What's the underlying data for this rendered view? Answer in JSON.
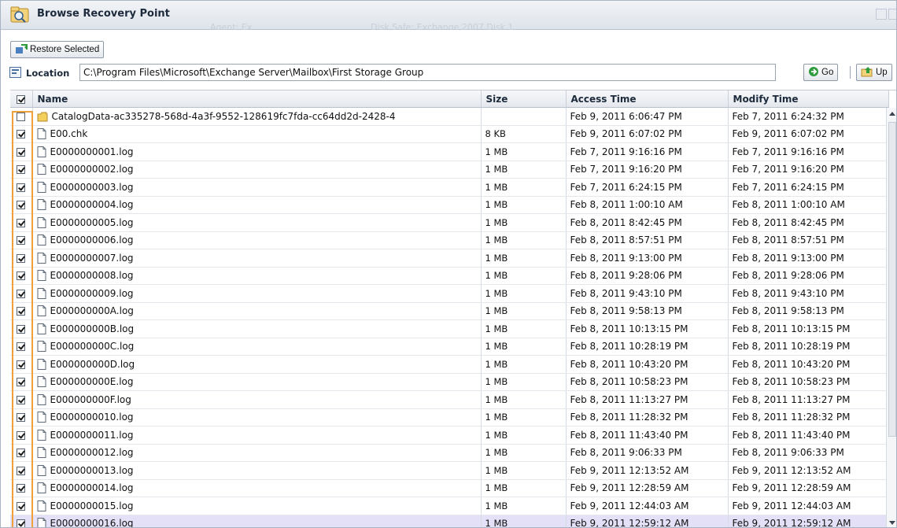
{
  "window": {
    "title": "Browse Recovery Point"
  },
  "background_ghost": {
    "items": [
      "Agent: Ex",
      "Disk Safe: Exchange 2007 Disk 1"
    ]
  },
  "toolbar": {
    "restore_label": "Restore Selected"
  },
  "location": {
    "label": "Location",
    "value": "C:\\Program Files\\Microsoft\\Exchange Server\\Mailbox\\First Storage Group",
    "go_label": "Go",
    "up_label": "Up"
  },
  "columns": {
    "name": "Name",
    "size": "Size",
    "access": "Access Time",
    "modify": "Modify Time"
  },
  "rows": [
    {
      "type": "folder",
      "checked": false,
      "name": "CatalogData-ac335278-568d-4a3f-9552-128619fc7fda-cc64dd2d-2428-4",
      "size": "",
      "access": "Feb 9, 2011 6:06:47 PM",
      "modify": "Feb 7, 2011 6:24:32 PM"
    },
    {
      "type": "file",
      "checked": true,
      "name": "E00.chk",
      "size": "8 KB",
      "access": "Feb 9, 2011 6:07:02 PM",
      "modify": "Feb 9, 2011 6:07:02 PM"
    },
    {
      "type": "file",
      "checked": true,
      "name": "E0000000001.log",
      "size": "1 MB",
      "access": "Feb 7, 2011 9:16:16 PM",
      "modify": "Feb 7, 2011 9:16:16 PM"
    },
    {
      "type": "file",
      "checked": true,
      "name": "E0000000002.log",
      "size": "1 MB",
      "access": "Feb 7, 2011 9:16:20 PM",
      "modify": "Feb 7, 2011 9:16:20 PM"
    },
    {
      "type": "file",
      "checked": true,
      "name": "E0000000003.log",
      "size": "1 MB",
      "access": "Feb 7, 2011 6:24:15 PM",
      "modify": "Feb 7, 2011 6:24:15 PM"
    },
    {
      "type": "file",
      "checked": true,
      "name": "E0000000004.log",
      "size": "1 MB",
      "access": "Feb 8, 2011 1:00:10 AM",
      "modify": "Feb 8, 2011 1:00:10 AM"
    },
    {
      "type": "file",
      "checked": true,
      "name": "E0000000005.log",
      "size": "1 MB",
      "access": "Feb 8, 2011 8:42:45 PM",
      "modify": "Feb 8, 2011 8:42:45 PM"
    },
    {
      "type": "file",
      "checked": true,
      "name": "E0000000006.log",
      "size": "1 MB",
      "access": "Feb 8, 2011 8:57:51 PM",
      "modify": "Feb 8, 2011 8:57:51 PM"
    },
    {
      "type": "file",
      "checked": true,
      "name": "E0000000007.log",
      "size": "1 MB",
      "access": "Feb 8, 2011 9:13:00 PM",
      "modify": "Feb 8, 2011 9:13:00 PM"
    },
    {
      "type": "file",
      "checked": true,
      "name": "E0000000008.log",
      "size": "1 MB",
      "access": "Feb 8, 2011 9:28:06 PM",
      "modify": "Feb 8, 2011 9:28:06 PM"
    },
    {
      "type": "file",
      "checked": true,
      "name": "E0000000009.log",
      "size": "1 MB",
      "access": "Feb 8, 2011 9:43:10 PM",
      "modify": "Feb 8, 2011 9:43:10 PM"
    },
    {
      "type": "file",
      "checked": true,
      "name": "E000000000A.log",
      "size": "1 MB",
      "access": "Feb 8, 2011 9:58:13 PM",
      "modify": "Feb 8, 2011 9:58:13 PM"
    },
    {
      "type": "file",
      "checked": true,
      "name": "E000000000B.log",
      "size": "1 MB",
      "access": "Feb 8, 2011 10:13:15 PM",
      "modify": "Feb 8, 2011 10:13:15 PM"
    },
    {
      "type": "file",
      "checked": true,
      "name": "E000000000C.log",
      "size": "1 MB",
      "access": "Feb 8, 2011 10:28:19 PM",
      "modify": "Feb 8, 2011 10:28:19 PM"
    },
    {
      "type": "file",
      "checked": true,
      "name": "E000000000D.log",
      "size": "1 MB",
      "access": "Feb 8, 2011 10:43:20 PM",
      "modify": "Feb 8, 2011 10:43:20 PM"
    },
    {
      "type": "file",
      "checked": true,
      "name": "E000000000E.log",
      "size": "1 MB",
      "access": "Feb 8, 2011 10:58:23 PM",
      "modify": "Feb 8, 2011 10:58:23 PM"
    },
    {
      "type": "file",
      "checked": true,
      "name": "E000000000F.log",
      "size": "1 MB",
      "access": "Feb 8, 2011 11:13:27 PM",
      "modify": "Feb 8, 2011 11:13:27 PM"
    },
    {
      "type": "file",
      "checked": true,
      "name": "E0000000010.log",
      "size": "1 MB",
      "access": "Feb 8, 2011 11:28:32 PM",
      "modify": "Feb 8, 2011 11:28:32 PM"
    },
    {
      "type": "file",
      "checked": true,
      "name": "E0000000011.log",
      "size": "1 MB",
      "access": "Feb 8, 2011 11:43:40 PM",
      "modify": "Feb 8, 2011 11:43:40 PM"
    },
    {
      "type": "file",
      "checked": true,
      "name": "E0000000012.log",
      "size": "1 MB",
      "access": "Feb 8, 2011 9:06:33 PM",
      "modify": "Feb 8, 2011 9:06:33 PM"
    },
    {
      "type": "file",
      "checked": true,
      "name": "E0000000013.log",
      "size": "1 MB",
      "access": "Feb 9, 2011 12:13:52 AM",
      "modify": "Feb 9, 2011 12:13:52 AM"
    },
    {
      "type": "file",
      "checked": true,
      "name": "E0000000014.log",
      "size": "1 MB",
      "access": "Feb 9, 2011 12:28:59 AM",
      "modify": "Feb 9, 2011 12:28:59 AM"
    },
    {
      "type": "file",
      "checked": true,
      "name": "E0000000015.log",
      "size": "1 MB",
      "access": "Feb 9, 2011 12:44:03 AM",
      "modify": "Feb 9, 2011 12:44:03 AM"
    },
    {
      "type": "file",
      "checked": true,
      "name": "E0000000016.log",
      "size": "1 MB",
      "access": "Feb 9, 2011 12:59:12 AM",
      "modify": "Feb 9, 2011 12:59:12 AM",
      "selected": true
    }
  ],
  "header_checkbox": {
    "checked": true
  },
  "colors": {
    "highlight_border": "#f0a038",
    "selected_row": "#e4e0f7",
    "title_text": "#1c2a3c"
  }
}
